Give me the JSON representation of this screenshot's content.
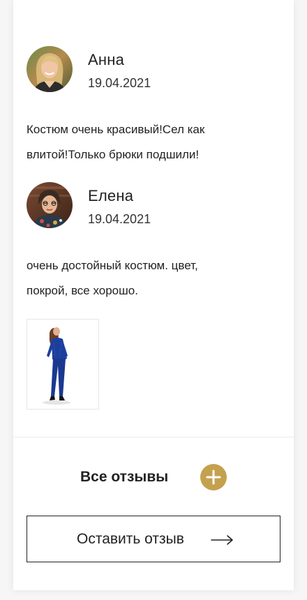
{
  "reviews": [
    {
      "author": "Анна",
      "date": "19.04.2021",
      "text": "Костюм очень красивый!Сел как влитой!Только брюки подшили!",
      "avatar_icon": "woman-blonde-photo"
    },
    {
      "author": "Елена",
      "date": "19.04.2021",
      "text": "очень достойный костюм. цвет, покрой, все хорошо.",
      "avatar_icon": "woman-dark-hair-photo",
      "photo": "blue-suit-photo"
    }
  ],
  "footer": {
    "all_reviews_label": "Все отзывы",
    "leave_review_label": "Оставить отзыв"
  },
  "colors": {
    "accent_gold": "#c4a14e",
    "border": "#222222",
    "divider": "#ebebeb"
  }
}
